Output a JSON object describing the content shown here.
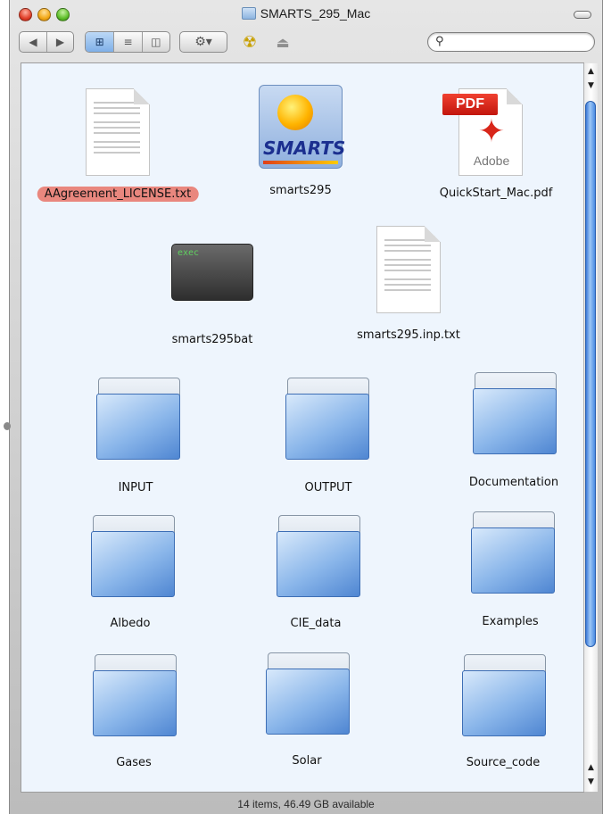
{
  "window": {
    "title": "SMARTS_295_Mac",
    "status": "14 items, 46.49 GB available"
  },
  "toolbar": {
    "view_icon": "⊞",
    "list_icon": "≡",
    "column_icon": "◫",
    "action_icon": "⚙▾",
    "burn_icon": "☢",
    "eject_icon": "⏏",
    "search": {
      "value": "",
      "placeholder": ""
    }
  },
  "items": [
    {
      "name": "AAgreement_LICENSE.txt",
      "kind": "text-document",
      "selected": true
    },
    {
      "name": "smarts295",
      "kind": "application"
    },
    {
      "name": "QuickStart_Mac.pdf",
      "kind": "pdf-document",
      "badge": "PDF",
      "brand": "Adobe"
    },
    {
      "name": "smarts295bat",
      "kind": "unix-executable",
      "badge": "exec"
    },
    {
      "name": "smarts295.inp.txt",
      "kind": "text-document"
    },
    {
      "name": "INPUT",
      "kind": "folder"
    },
    {
      "name": "OUTPUT",
      "kind": "folder"
    },
    {
      "name": "Documentation",
      "kind": "folder"
    },
    {
      "name": "Albedo",
      "kind": "folder"
    },
    {
      "name": "CIE_data",
      "kind": "folder"
    },
    {
      "name": "Examples",
      "kind": "folder"
    },
    {
      "name": "Gases",
      "kind": "folder"
    },
    {
      "name": "Solar",
      "kind": "folder"
    },
    {
      "name": "Source_code",
      "kind": "folder"
    }
  ],
  "app_icon_text": "SMARTS",
  "colors": {
    "selection": "#e9877e",
    "folder_blue": "#8ab6ea",
    "pdf_red": "#d8261a",
    "window_bg": "#eef5fd"
  }
}
